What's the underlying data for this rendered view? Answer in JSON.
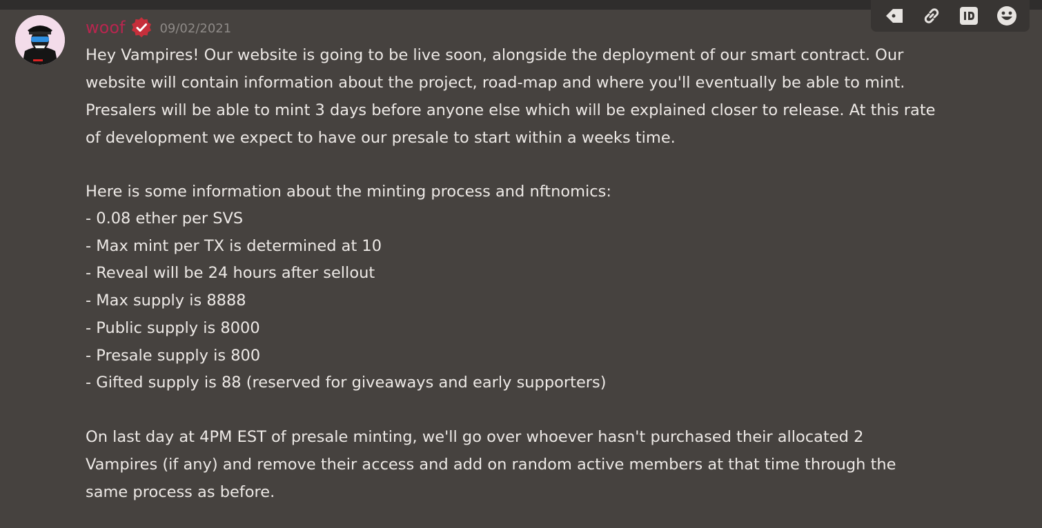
{
  "message": {
    "author": "woof",
    "author_color": "#b8264f",
    "verified_badge_icon": "check-badge-icon",
    "verified_badge_color": "#c62f3b",
    "timestamp": "09/02/2021",
    "paragraph1": [
      "Hey Vampires! Our website is going to be live soon, alongside the deployment of our smart contract.  Our",
      "website will contain information about the project, road-map and where you'll eventually be able to mint.",
      "Presalers will be able to mint 3 days before anyone else which will be explained closer to release. At this rate",
      "of development we expect to have our presale to start within a weeks time."
    ],
    "list_intro": "Here is some information about the minting process and nftnomics:",
    "list_items": [
      "- 0.08 ether per SVS",
      "- Max mint per TX is determined at 10",
      "- Reveal will be 24 hours after sellout",
      "- Max supply is 8888",
      "- Public supply is 8000",
      "- Presale supply is 800",
      "- Gifted supply is 88 (reserved for giveaways and early supporters)"
    ],
    "paragraph3": [
      "On last day at 4PM EST of presale minting, we'll go over whoever hasn't purchased their allocated 2",
      "Vampires (if any) and remove their access and add on random active members at that time through the",
      "same process as before."
    ]
  },
  "toolbar": {
    "buttons": [
      "tag-icon",
      "link-icon",
      "id-icon",
      "emoji-icon"
    ]
  }
}
